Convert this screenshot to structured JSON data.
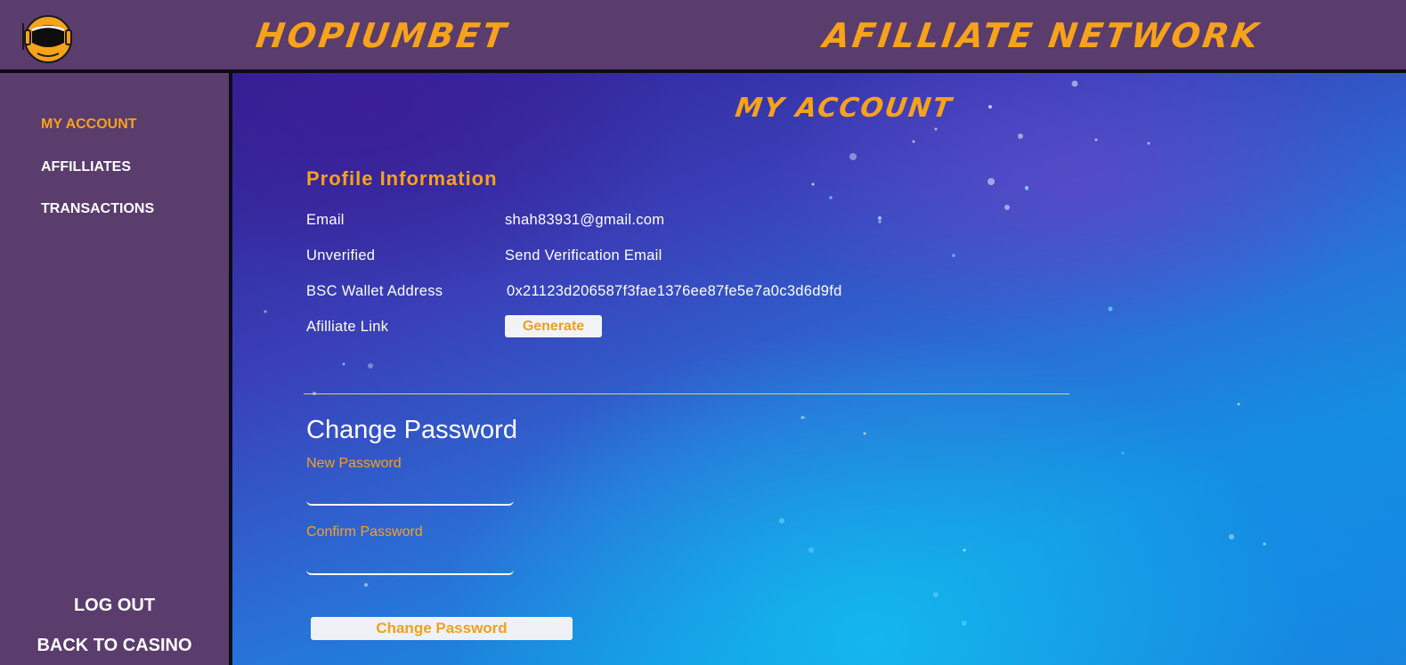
{
  "header": {
    "brand_left": "HOPIUMBET",
    "brand_right": "AFILLIATE NETWORK",
    "logo_icon": "astronaut-helmet-icon"
  },
  "sidebar": {
    "items": [
      {
        "label": "MY ACCOUNT",
        "active": true
      },
      {
        "label": "AFFILLIATES",
        "active": false
      },
      {
        "label": "TRANSACTIONS",
        "active": false
      }
    ],
    "logout_label": "LOG OUT",
    "back_label": "BACK TO CASINO"
  },
  "main": {
    "page_title": "MY ACCOUNT",
    "profile": {
      "title": "Profile Information",
      "rows": [
        {
          "label": "Email",
          "value": "shah83931@gmail.com"
        },
        {
          "label": "Unverified",
          "value": "Send Verification Email"
        },
        {
          "label": "BSC Wallet Address",
          "value": "0x21123d206587f3fae1376ee87fe5e7a0c3d6d9fd"
        },
        {
          "label": "Afilliate Link",
          "button": "Generate"
        }
      ]
    },
    "change_password": {
      "title": "Change Password",
      "new_label": "New Password",
      "new_value": "",
      "confirm_label": "Confirm Password",
      "confirm_value": "",
      "button": "Change Password"
    }
  },
  "colors": {
    "accent": "#f7a21b",
    "panel": "#5a3c6d",
    "border": "#0c0c14",
    "text": "#ffffff"
  }
}
